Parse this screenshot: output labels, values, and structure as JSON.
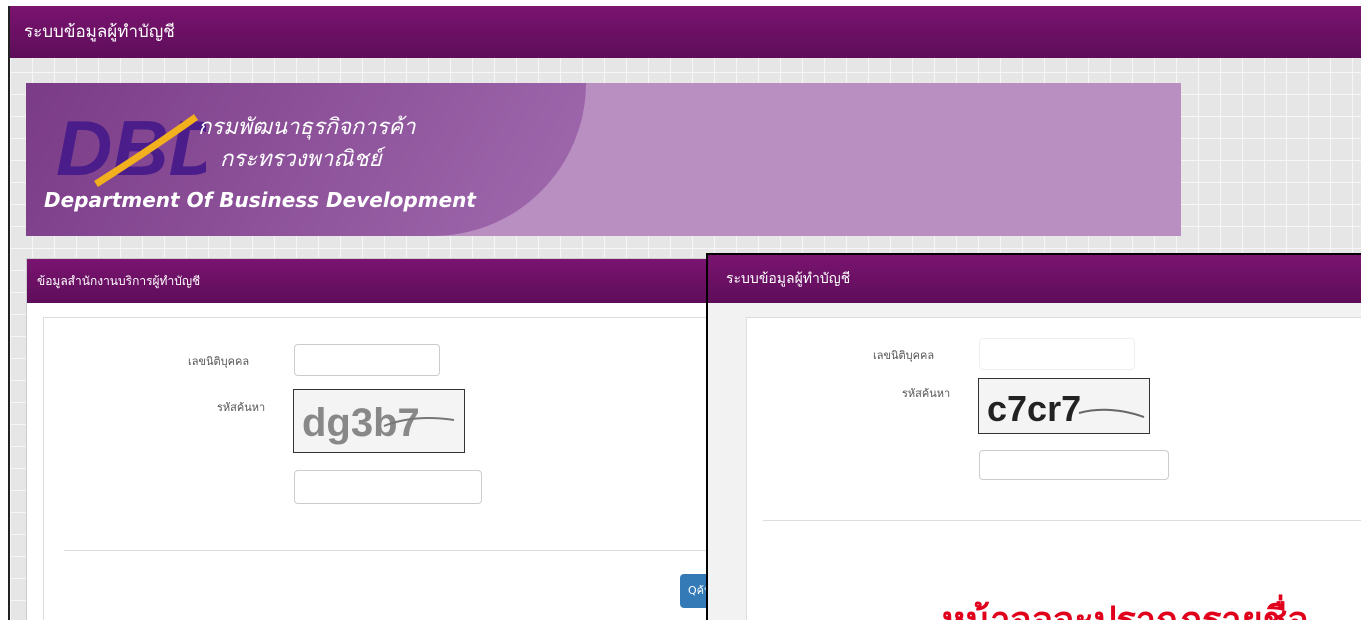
{
  "window": {
    "title": "ระบบข้อมูลผู้ทำบัญชี"
  },
  "banner": {
    "logo_text": "DBD",
    "thai_line1": "กรมพัฒนาธุรกิจการค้า",
    "thai_line2": "กระทรวงพาณิชย์",
    "english": "Department Of Business Development"
  },
  "left_panel": {
    "header": "ข้อมูลสำนักงานบริการผู้ทำบัญชี",
    "juristic_label": "เลขนิติบุคคล",
    "juristic_value": "",
    "captcha_label": "รหัสค้นหา",
    "captcha_text": "dg3b7",
    "captcha_input_value": "",
    "search_button": "Qค้น"
  },
  "overlay": {
    "header": "ระบบข้อมูลผู้ทำบัญชี",
    "juristic_label": "เลขนิติบุคคล",
    "juristic_value": "",
    "captcha_label": "รหัสค้นหา",
    "captcha_text": "c7cr7",
    "captcha_input_value": "",
    "note": "หน้าจอจะปรากฏรายชื่อ"
  },
  "colors": {
    "header_purple": "#6a1265",
    "banner_purple": "#b98fc2",
    "button_blue": "#337ab7",
    "note_red": "#e0001b"
  }
}
